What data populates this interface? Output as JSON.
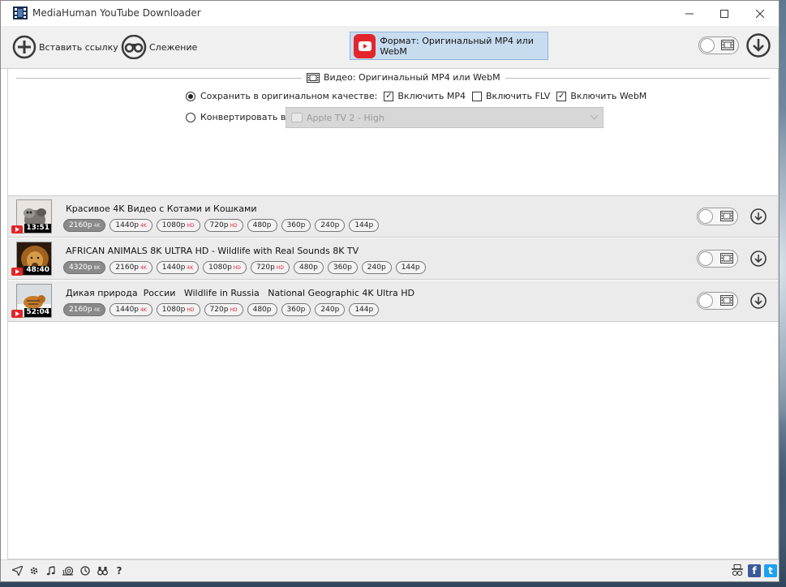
{
  "window": {
    "title": "MediaHuman YouTube Downloader"
  },
  "toolbar": {
    "paste_label": "Вставить ссылку",
    "tracking_label": "Слежение",
    "format_label": "Формат: Оригинальный MP4 или WebM"
  },
  "settings": {
    "section_title": "Видео: Оригинальный MP4 или WebM",
    "keep_original_label": "Сохранить в оригинальном качестве:",
    "include_mp4_label": "Включить MP4",
    "include_flv_label": "Включить FLV",
    "include_webm_label": "Включить WebM",
    "include_mp4_checked": true,
    "include_flv_checked": false,
    "include_webm_checked": true,
    "convert_label": "Конвертировать в:",
    "convert_selected": "Apple TV 2 - High",
    "keep_original_selected": true
  },
  "downloads": [
    {
      "title": "Красивое 4K Видео с Котами и Кошками",
      "duration": "13:51",
      "qualities": [
        {
          "label": "2160p",
          "badge": "4K",
          "selected": true
        },
        {
          "label": "1440p",
          "badge": "4K",
          "selected": false
        },
        {
          "label": "1080p",
          "badge": "HD",
          "selected": false
        },
        {
          "label": "720p",
          "badge": "HD",
          "selected": false
        },
        {
          "label": "480p",
          "badge": "",
          "selected": false
        },
        {
          "label": "360p",
          "badge": "",
          "selected": false
        },
        {
          "label": "240p",
          "badge": "",
          "selected": false
        },
        {
          "label": "144p",
          "badge": "",
          "selected": false
        }
      ]
    },
    {
      "title": "AFRICAN ANIMALS 8K ULTRA HD - Wildlife with Real Sounds 8K TV",
      "duration": "48:40",
      "qualities": [
        {
          "label": "4320p",
          "badge": "8K",
          "selected": true
        },
        {
          "label": "2160p",
          "badge": "4K",
          "selected": false
        },
        {
          "label": "1440p",
          "badge": "4K",
          "selected": false
        },
        {
          "label": "1080p",
          "badge": "HD",
          "selected": false
        },
        {
          "label": "720p",
          "badge": "HD",
          "selected": false
        },
        {
          "label": "480p",
          "badge": "",
          "selected": false
        },
        {
          "label": "360p",
          "badge": "",
          "selected": false
        },
        {
          "label": "240p",
          "badge": "",
          "selected": false
        },
        {
          "label": "144p",
          "badge": "",
          "selected": false
        }
      ]
    },
    {
      "title": "Дикая природа  России   Wildlife in Russia   National Geographic 4K Ultra HD",
      "duration": "52:04",
      "qualities": [
        {
          "label": "2160p",
          "badge": "4K",
          "selected": true
        },
        {
          "label": "1440p",
          "badge": "4K",
          "selected": false
        },
        {
          "label": "1080p",
          "badge": "HD",
          "selected": false
        },
        {
          "label": "720p",
          "badge": "HD",
          "selected": false
        },
        {
          "label": "480p",
          "badge": "",
          "selected": false
        },
        {
          "label": "360p",
          "badge": "",
          "selected": false
        },
        {
          "label": "240p",
          "badge": "",
          "selected": false
        },
        {
          "label": "144p",
          "badge": "",
          "selected": false
        }
      ]
    }
  ],
  "bottom_bar": {
    "icons": [
      "send-icon",
      "gear-icon",
      "music-note-icon",
      "snail-icon",
      "clock-icon",
      "binoculars-icon",
      "help-icon"
    ],
    "help_glyph": "?",
    "facebook_glyph": "f",
    "twitter_glyph": "t"
  },
  "colors": {
    "youtube_red": "#e3262b",
    "format_highlight": "#c8dcf0",
    "selected_chip": "#8a8a8a",
    "facebook": "#3b5998",
    "twitter": "#1da1f2"
  }
}
